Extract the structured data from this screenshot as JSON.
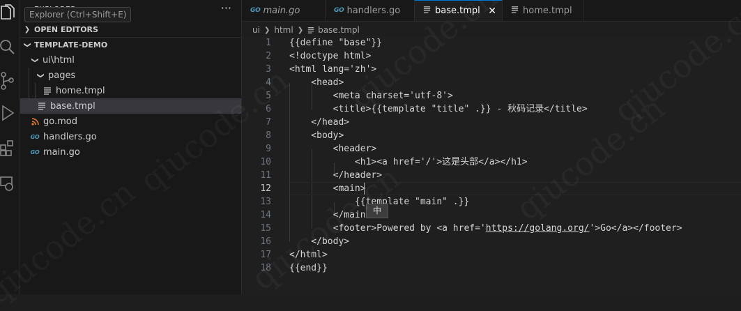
{
  "sidebar": {
    "title": "EXPLORER",
    "tooltip": "Explorer (Ctrl+Shift+E)",
    "more": "···",
    "open_editors": "OPEN EDITORS",
    "project": "TEMPLATE-DEMO",
    "tree": {
      "ui_html": "ui\\html",
      "pages": "pages",
      "home": "home.tmpl",
      "base": "base.tmpl",
      "gomod": "go.mod",
      "handlers": "handlers.go",
      "main": "main.go"
    }
  },
  "tabs": {
    "go_badge": "GO",
    "t1": "main.go",
    "t2": "handlers.go",
    "t3": "base.tmpl",
    "t4": "home.tmpl",
    "close": "✕"
  },
  "breadcrumb": {
    "p1": "ui",
    "p2": "html",
    "p3": "base.tmpl"
  },
  "ime": "中",
  "watermark": "qiucode.cn",
  "code": {
    "l1": "{{define \"base\"}}",
    "l2": "<!doctype html>",
    "l3": "<html lang='zh'>",
    "l4": "    <head>",
    "l5": "        <meta charset='utf-8'>",
    "l6": "        <title>{{template \"title\" .}} - 秋码记录</title>",
    "l7": "    </head>",
    "l8": "    <body>",
    "l9": "        <header>",
    "l10": "            <h1><a href='/'>这是头部</a></h1>",
    "l11": "        </header>",
    "l12": "        <main>",
    "l13": "            {{template \"main\" .}}",
    "l14": "        </main>",
    "l15a": "        <footer>Powered by <a href='",
    "l15b": "https://golang.org/",
    "l15c": "'>Go</a></footer>",
    "l16": "    </body>",
    "l17": "</html>",
    "l18": "{{end}}"
  },
  "line_numbers": [
    "1",
    "2",
    "3",
    "4",
    "5",
    "6",
    "7",
    "8",
    "9",
    "10",
    "11",
    "12",
    "13",
    "14",
    "15",
    "16",
    "17",
    "18"
  ]
}
